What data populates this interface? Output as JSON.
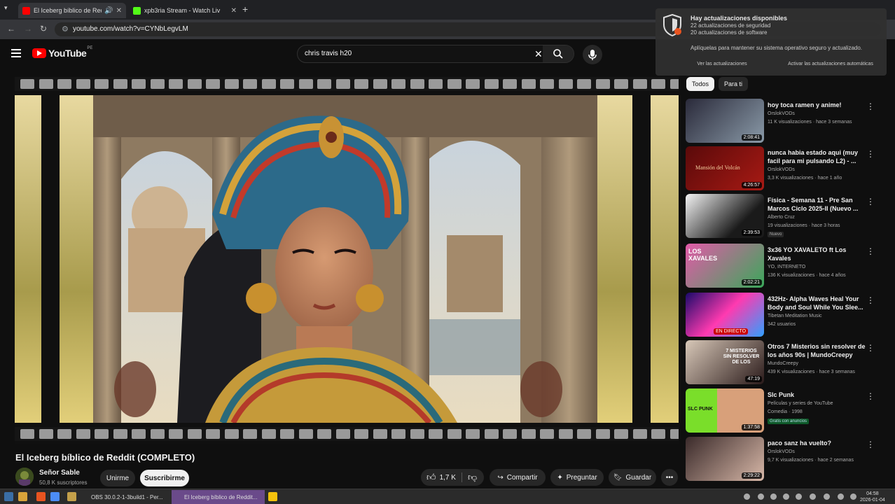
{
  "browser": {
    "tabs": [
      {
        "title": "El Iceberg bíblico de Redd",
        "active": true
      },
      {
        "title": "xpb3ria Stream - Watch Liv",
        "active": false
      }
    ],
    "url": "youtube.com/watch?v=CYNbLegvLM"
  },
  "youtube": {
    "logo_text": "YouTube",
    "country_code": "PE",
    "search_query": "chris travis h20"
  },
  "video": {
    "title": "El Iceberg bíblico de Reddit (COMPLETO)",
    "channel": "Señor Sable",
    "subscribers": "50,8 K suscriptores",
    "join_label": "Unirme",
    "subscribe_label": "Suscribirme",
    "likes": "1,7 K",
    "share_label": "Compartir",
    "ask_label": "Preguntar",
    "save_label": "Guardar",
    "more_label": "•••"
  },
  "sidebar": {
    "chips": [
      "Todos",
      "Para ti"
    ],
    "items": [
      {
        "title": "hoy toca ramen y anime!",
        "channel": "OrslokVODs",
        "meta": "11 K visualizaciones · hace 3 semanas",
        "duration": "2:08:41",
        "badge": ""
      },
      {
        "title": "nunca habia estado aqui (muy facil para mi pulsando L2) - ...",
        "channel": "OrslokVODs",
        "meta": "3,3 K visualizaciones · hace 1 año",
        "duration": "4:26:57",
        "badge": ""
      },
      {
        "title": "Física - Semana 11 - Pre San Marcos Ciclo 2025-II (Nuevo ...",
        "channel": "Alberto Cruz",
        "meta": "19 visualizaciones · hace 3 horas",
        "duration": "2:39:53",
        "badge": "Nuevo"
      },
      {
        "title": "3x36 YO XAVALETO ft Los Xavales",
        "channel": "YO, INTERNETO",
        "meta": "136 K visualizaciones · hace 4 años",
        "duration": "2:02:21",
        "badge": ""
      },
      {
        "title": "432Hz- Alpha Waves Heal Your Body and Soul While You Slee...",
        "channel": "Tibetan Meditation Music",
        "meta": "342 usuarios",
        "duration": "EN DIRECTO",
        "badge": ""
      },
      {
        "title": "Otros 7 Misterios sin resolver de los años 90s | MundoCreepy",
        "channel": "MundoCreepy",
        "meta": "439 K visualizaciones · hace 3 semanas",
        "duration": "47:19",
        "badge": ""
      },
      {
        "title": "Slc Punk",
        "channel": "Películas y series de YouTube",
        "meta": "Comedia · 1998",
        "duration": "1:37:58",
        "badge": "Gratis con anuncios"
      },
      {
        "title": "paco sanz ha vuelto?",
        "channel": "OrslokVODs",
        "meta": "9,7 K visualizaciones · hace 2 semanas",
        "duration": "2:29:22",
        "badge": ""
      }
    ],
    "thumb_texts": [
      "Mansión del Volcán",
      "LOS XAVALES",
      "SLC PUNK",
      "7 MISTERIOS SIN RESOLVER DE LOS"
    ]
  },
  "notification": {
    "heading": "Hay actualizaciones disponibles",
    "line1": "22 actualizaciones de seguridad",
    "line2": "20 actualizaciones de software",
    "body": "Aplíquelas para mantener su sistema operativo seguro y actualizado.",
    "action1": "Ver las actualizaciones",
    "action2": "Activar las actualizaciones automáticas"
  },
  "taskbar": {
    "tasks": [
      "OBS 30.0.2-1-3build1 - Per...",
      "El Iceberg bíblico de Reddit..."
    ],
    "time": "04:58",
    "date": "2026-01-04"
  },
  "colors": {
    "yt_red": "#ff0000",
    "background": "#0f0f0f",
    "gold": "#d8c07a"
  }
}
